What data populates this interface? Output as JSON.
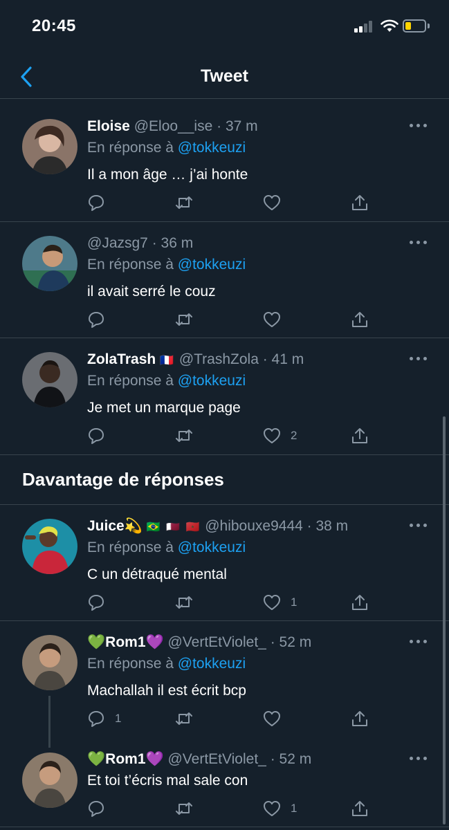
{
  "status_bar": {
    "time": "20:45"
  },
  "nav": {
    "title": "Tweet"
  },
  "section_title": "Davantage de réponses",
  "tweets": [
    {
      "name": "Eloise",
      "flags": "",
      "handle": "@Eloo__ise",
      "time": "· 37 m",
      "reply_label": "En réponse à",
      "reply_to": "@tokkeuzi",
      "text": "Il a mon âge … j’ai honte",
      "reply_count": "",
      "like_count": "",
      "avatar_color": "#6e4f41"
    },
    {
      "name": "",
      "flags": "",
      "handle": "@Jazsg7",
      "time": "· 36 m",
      "reply_label": "En réponse à",
      "reply_to": "@tokkeuzi",
      "text": "il avait serré le couz",
      "reply_count": "",
      "like_count": "",
      "avatar_color": "#3c6e58"
    },
    {
      "name": "ZolaTrash",
      "flags": "🇫🇷",
      "handle": "@TrashZola",
      "time": "· 41 m",
      "reply_label": "En réponse à",
      "reply_to": "@tokkeuzi",
      "text": "Je met un marque page",
      "reply_count": "",
      "like_count": "2",
      "avatar_color": "#4a4d52"
    },
    {
      "name": "Juice💫",
      "flags": "🇧🇷 🇶🇦 🇲🇦",
      "handle": "@hibouxe9444",
      "time": "· 38 m",
      "reply_label": "En réponse à",
      "reply_to": "@tokkeuzi",
      "text": "C un détraqué mental",
      "reply_count": "",
      "like_count": "1",
      "avatar_color": "#c9263a"
    },
    {
      "name": "💚Rom1💜",
      "flags": "",
      "handle": "@VertEtViolet_",
      "time": "· 52 m",
      "reply_label": "En réponse à",
      "reply_to": "@tokkeuzi",
      "text": "Machallah il est écrit bcp",
      "reply_count": "1",
      "like_count": "",
      "avatar_color": "#5a4a3e"
    },
    {
      "name": "💚Rom1💜",
      "flags": "",
      "handle": "@VertEtViolet_",
      "time": "· 52 m",
      "text": "Et toi t’écris mal sale con",
      "reply_count": "",
      "like_count": "1",
      "avatar_color": "#5a4a3e"
    }
  ],
  "colors": {
    "background": "#15202b",
    "accent": "#1da1f2",
    "muted": "#8b98a5",
    "divider": "#38444d"
  },
  "icons": [
    "back-chevron-icon",
    "more-icon",
    "reply-icon",
    "retweet-icon",
    "like-icon",
    "share-icon"
  ]
}
